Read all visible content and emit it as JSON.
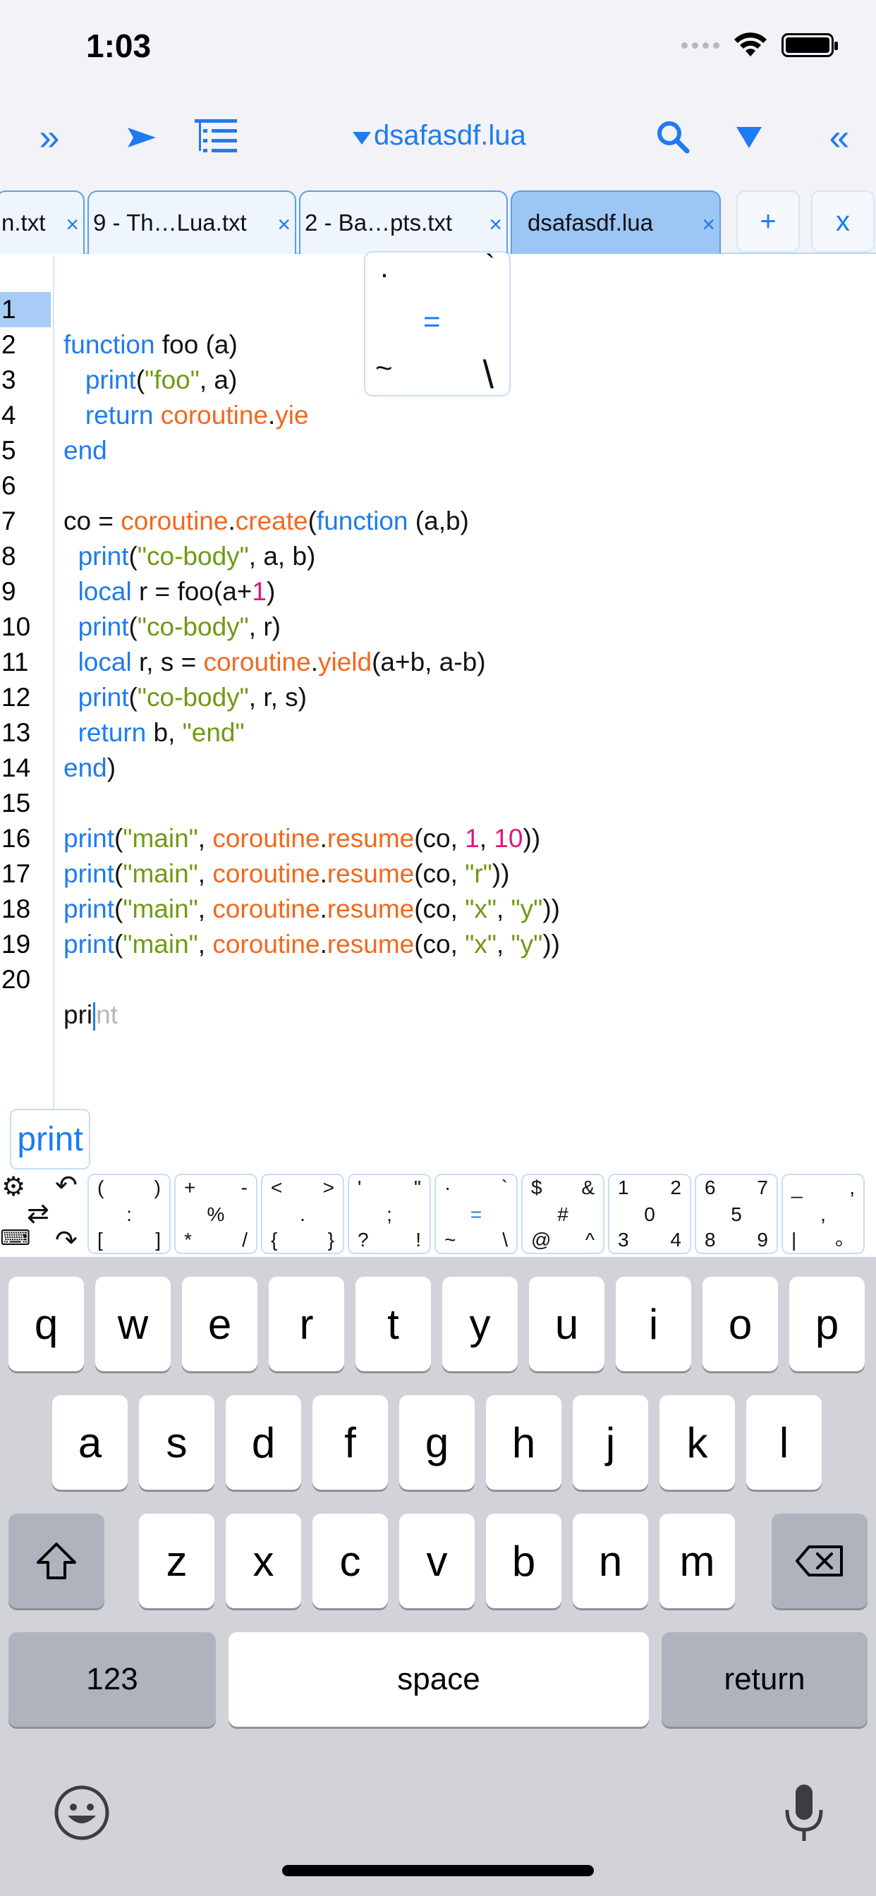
{
  "status": {
    "time": "1:03"
  },
  "toolbar": {
    "left_panel_icon": "»",
    "run_icon": "▶",
    "outline_icon": "outline",
    "file_name": "dsafasdf.lua",
    "search_icon": "search",
    "filter_icon": "▼",
    "right_panel_icon": "«"
  },
  "tabs": [
    {
      "label": "n.txt",
      "close": "×"
    },
    {
      "label": "9 - Th…Lua.txt",
      "close": "×"
    },
    {
      "label": "2 - Ba…pts.txt",
      "close": "×"
    },
    {
      "label": "dsafasdf.lua",
      "close": "×"
    }
  ],
  "tab_actions": {
    "add": "+",
    "close": "x"
  },
  "editor": {
    "line_numbers": [
      "1",
      "2",
      "3",
      "4",
      "5",
      "6",
      "7",
      "8",
      "9",
      "10",
      "11",
      "12",
      "13",
      "14",
      "15",
      "16",
      "17",
      "18",
      "19",
      "20"
    ],
    "current_line_typed": "pri",
    "current_line_ghost": "nt"
  },
  "symbol_popup": {
    "top_left": "·",
    "top_right": "`",
    "center": "=",
    "bottom_left": "~",
    "bottom_right": "\\"
  },
  "autocomplete": {
    "suggestion": "print"
  },
  "extra_keys": [
    {
      "tl": "(",
      "tr": ")",
      "mid": ":",
      "bl": "[",
      "br": "]"
    },
    {
      "tl": "+",
      "tr": "-",
      "mid": "%",
      "bl": "*",
      "br": "/"
    },
    {
      "tl": "<",
      "tr": ">",
      "mid": ".",
      "bl": "{",
      "br": "}"
    },
    {
      "tl": "'",
      "tr": "\"",
      "mid": ";",
      "bl": "?",
      "br": "!"
    },
    {
      "tl": "·",
      "tr": "`",
      "mid": "=",
      "bl": "~",
      "br": "\\"
    },
    {
      "tl": "$",
      "tr": "&",
      "mid": "#",
      "bl": "@",
      "br": "^"
    },
    {
      "tl": "1",
      "tr": "2",
      "mid": "0",
      "bl": "3",
      "br": "4"
    },
    {
      "tl": "6",
      "tr": "7",
      "mid": "5",
      "bl": "8",
      "br": "9"
    },
    {
      "tl": "_",
      "tr": ",",
      "mid": ",",
      "bl": "|",
      "br": "。"
    }
  ],
  "keyboard": {
    "row1": [
      "q",
      "w",
      "e",
      "r",
      "t",
      "y",
      "u",
      "i",
      "o",
      "p"
    ],
    "row2": [
      "a",
      "s",
      "d",
      "f",
      "g",
      "h",
      "j",
      "k",
      "l"
    ],
    "row3": [
      "z",
      "x",
      "c",
      "v",
      "b",
      "n",
      "m"
    ],
    "numbers_key": "123",
    "space_key": "space",
    "return_key": "return"
  },
  "colors": {
    "accent": "#1e7bf0",
    "keyword": "#1e7bf0",
    "library": "#f2681e",
    "string": "#6f9a12",
    "number": "#e0147d"
  }
}
